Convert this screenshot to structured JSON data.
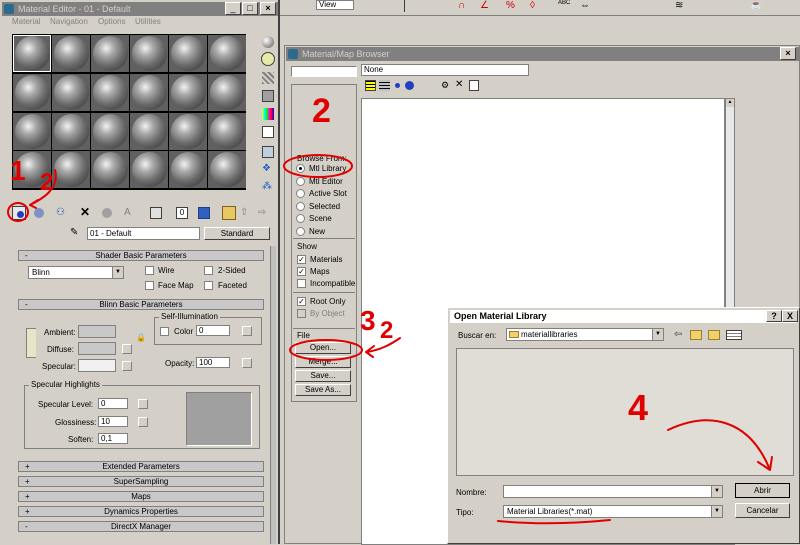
{
  "material_editor": {
    "title": "Material Editor - 01 - Default",
    "menu": [
      "Material",
      "Navigation",
      "Options",
      "Utilities"
    ],
    "material_name": "01 - Default",
    "material_type": "Standard",
    "shader_rollout": "Shader Basic Parameters",
    "shader_type": "Blinn",
    "wire": "Wire",
    "two_sided": "2-Sided",
    "face_map": "Face Map",
    "faceted": "Faceted",
    "blinn_rollout": "Blinn Basic Parameters",
    "self_illum": "Self-Illumination",
    "ambient": "Ambient:",
    "diffuse": "Diffuse:",
    "specular": "Specular:",
    "color": "Color",
    "color_value": "0",
    "opacity": "Opacity:",
    "opacity_value": "100",
    "spec_highlights": "Specular Highlights",
    "spec_level": "Specular Level:",
    "spec_level_value": "0",
    "glossiness": "Glossiness:",
    "glossiness_value": "10",
    "soften": "Soften:",
    "soften_value": "0,1",
    "rollouts": [
      "Extended Parameters",
      "SuperSampling",
      "Maps",
      "Dynamics Properties",
      "DirectX Manager"
    ],
    "colors": {
      "ambient": "#c8c8c8",
      "diffuse": "#c8c8c8",
      "specular": "#f0f0f0",
      "preview": "#a0a0a0"
    }
  },
  "toolbar": {
    "view_label": "View"
  },
  "browser": {
    "title": "Material/Map Browser",
    "name_value": "None",
    "browse_from": "Browse From:",
    "browse_options": [
      "Mtl Library",
      "Mtl Editor",
      "Active Slot",
      "Selected",
      "Scene",
      "New"
    ],
    "show": "Show",
    "show_options": [
      "Materials",
      "Maps",
      "Incompatible"
    ],
    "root_only": "Root Only",
    "by_object": "By Object",
    "file": "File",
    "file_buttons": [
      "Open...",
      "Merge...",
      "Save...",
      "Save As..."
    ]
  },
  "dialog": {
    "title": "Open Material Library",
    "look_in_label": "Buscar en:",
    "look_in_value": "materiallibraries",
    "filename_label": "Nombre:",
    "filename_value": "",
    "type_label": "Tipo:",
    "type_value": "Material Libraries(*.mat)",
    "open_button": "Abrir",
    "cancel_button": "Cancelar",
    "help": "?",
    "close": "X"
  },
  "annotations": {
    "one": "1",
    "two_a": "2",
    "two_b": "2",
    "three": "3",
    "two_c": "2",
    "four": "4"
  }
}
